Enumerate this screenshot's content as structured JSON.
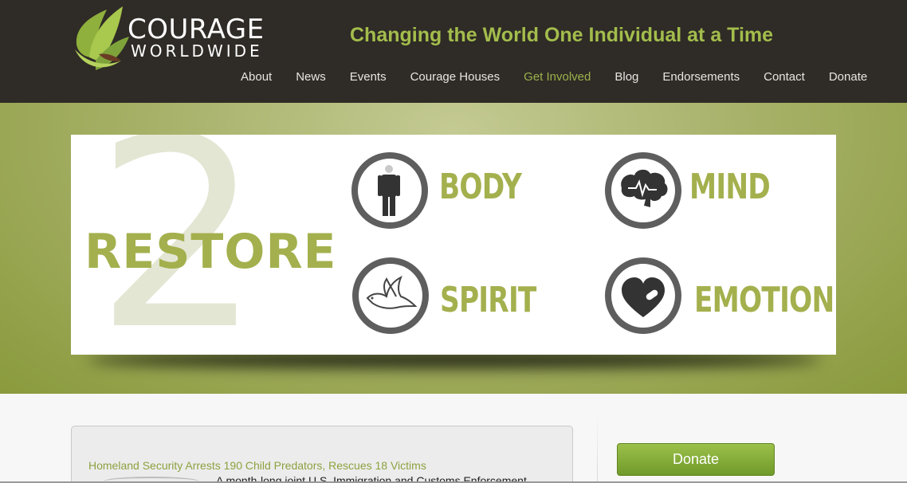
{
  "brand": {
    "name_line1": "COURAGE",
    "name_line2": "WORLDWIDE",
    "tagline": "Changing the World One Individual at a Time"
  },
  "nav": {
    "items": [
      {
        "label": "About",
        "active": false
      },
      {
        "label": "News",
        "active": false
      },
      {
        "label": "Events",
        "active": false
      },
      {
        "label": "Courage Houses",
        "active": false
      },
      {
        "label": "Get Involved",
        "active": true
      },
      {
        "label": "Blog",
        "active": false
      },
      {
        "label": "Endorsements",
        "active": false
      },
      {
        "label": "Contact",
        "active": false
      },
      {
        "label": "Donate",
        "active": false
      }
    ]
  },
  "banner": {
    "number": "2",
    "heading": "RESTORE",
    "pillars": [
      {
        "label": "BODY",
        "icon": "person-icon"
      },
      {
        "label": "MIND",
        "icon": "brain-icon"
      },
      {
        "label": "SPIRIT",
        "icon": "dove-icon"
      },
      {
        "label": "EMOTION",
        "icon": "heart-icon"
      }
    ]
  },
  "news": {
    "title": "Homeland Security Arrests 190 Child Predators, Rescues 18 Victims",
    "excerpt": "A month-long joint U.S. Immigration and Customs Enforcement"
  },
  "sidebar": {
    "donate_label": "Donate"
  },
  "colors": {
    "header_bg": "#2f2b26",
    "accent_green": "#a3bd4c",
    "banner_green": "#a8b26a",
    "active_nav": "#9cb24c"
  }
}
